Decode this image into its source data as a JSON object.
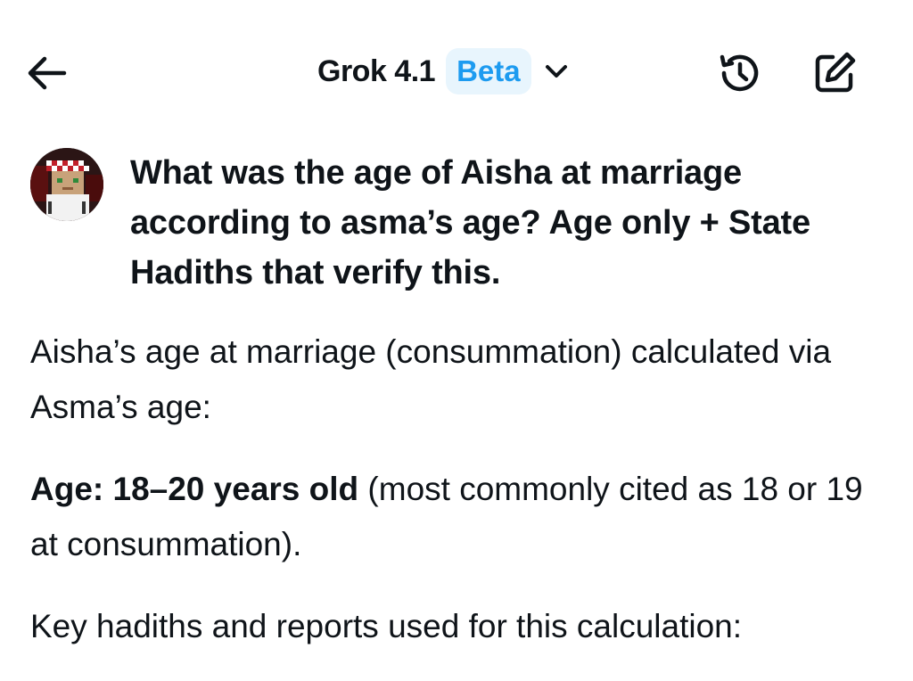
{
  "header": {
    "title": "Grok 4.1",
    "badge": "Beta",
    "icons": [
      "back-arrow-icon",
      "chevron-down-icon",
      "history-icon",
      "compose-icon"
    ]
  },
  "conversation": {
    "question": "What was the age of Aisha at marriage according to asma’s age? Age only + State Hadiths that verify this.",
    "answer": {
      "intro": "Aisha’s age at marriage (consummation) calculated via Asma’s age:",
      "age_label": "Age: 18–20 years old",
      "age_detail": " (most commonly cited as 18 or 19 at consummation).",
      "hadiths_intro": "Key hadiths and reports used for this calculation:"
    }
  },
  "colors": {
    "accent": "#1d9bf0",
    "badge_bg": "#e8f5fd",
    "text": "#0f1419"
  }
}
